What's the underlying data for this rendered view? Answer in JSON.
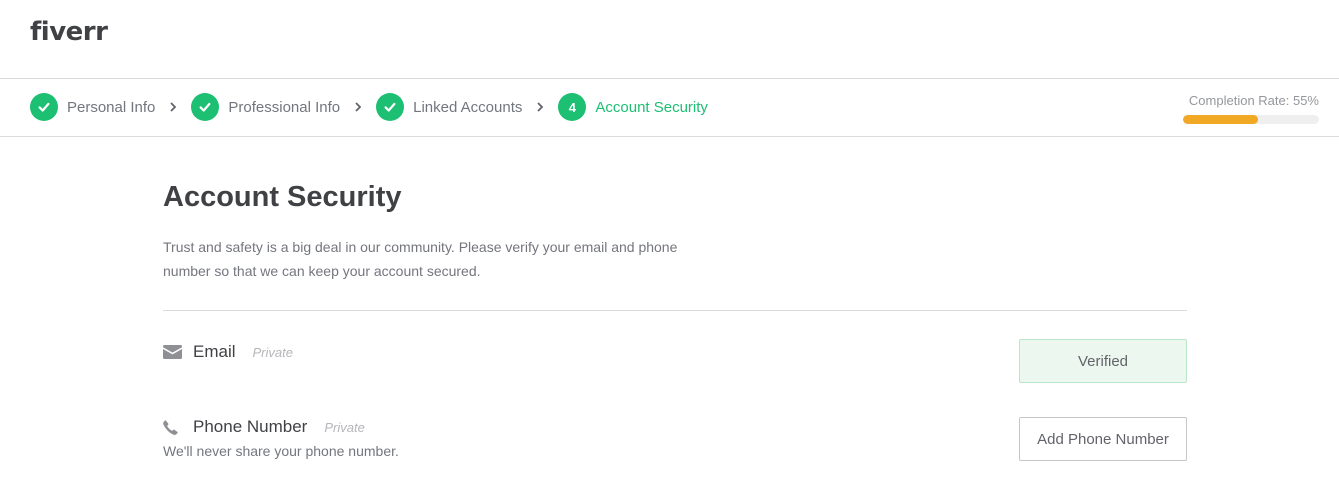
{
  "header": {
    "logo": "fiverr"
  },
  "steps": [
    {
      "label": "Personal Info",
      "state": "done"
    },
    {
      "label": "Professional Info",
      "state": "done"
    },
    {
      "label": "Linked Accounts",
      "state": "done"
    },
    {
      "label": "Account Security",
      "state": "active",
      "number": "4"
    }
  ],
  "completion": {
    "label": "Completion Rate: 55%",
    "value": 55
  },
  "main": {
    "title": "Account Security",
    "description": "Trust and safety is a big deal in our community. Please verify your email and phone number so that we can keep your account secured.",
    "email": {
      "icon": "envelope-icon",
      "label": "Email",
      "privacy": "Private",
      "button": "Verified"
    },
    "phone": {
      "icon": "phone-icon",
      "label": "Phone Number",
      "privacy": "Private",
      "note": "We'll never share your phone number.",
      "button": "Add Phone Number"
    }
  },
  "colors": {
    "brand_green": "#1dbf73",
    "progress_orange": "#f1a824",
    "verified_bg": "#ecf8ef"
  }
}
